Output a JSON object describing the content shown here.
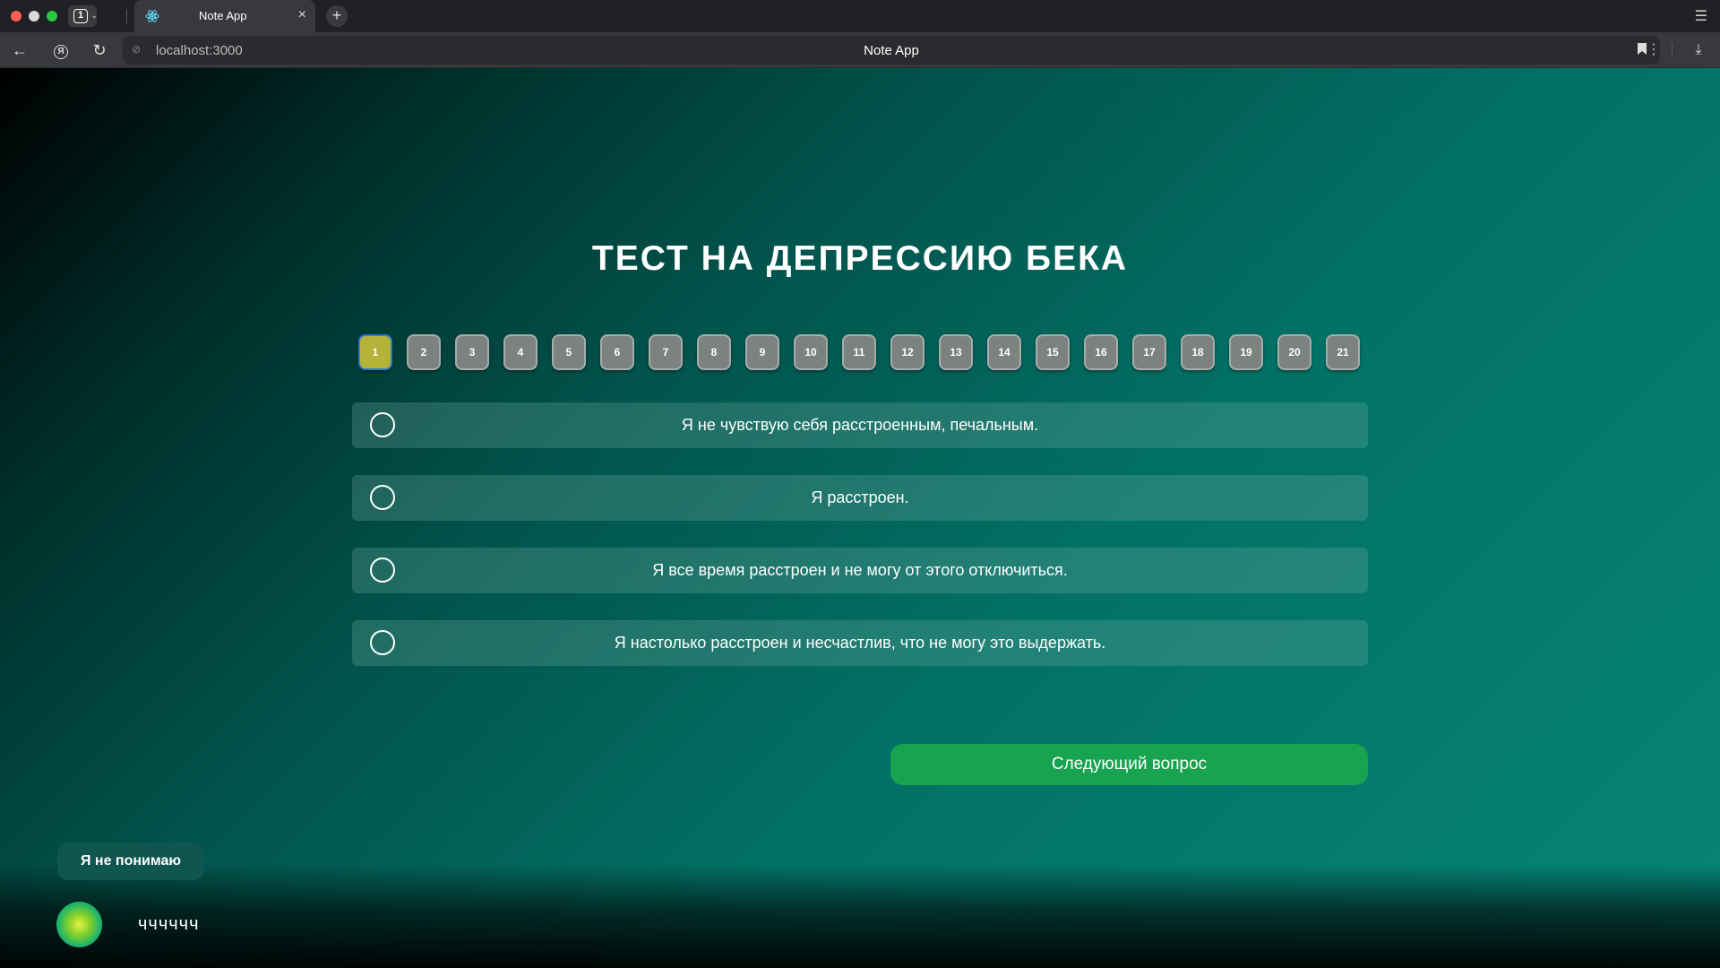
{
  "browser": {
    "tab_count": "1",
    "tab_title": "Note App",
    "url": "localhost:3000",
    "page_title": "Note App"
  },
  "quiz": {
    "title": "ТЕСТ НА ДЕПРЕССИЮ БЕКА",
    "question_numbers": [
      "1",
      "2",
      "3",
      "4",
      "5",
      "6",
      "7",
      "8",
      "9",
      "10",
      "11",
      "12",
      "13",
      "14",
      "15",
      "16",
      "17",
      "18",
      "19",
      "20",
      "21"
    ],
    "active_question": "1",
    "options": [
      "Я не чувствую себя расстроенным, печальным.",
      "Я расстроен.",
      "Я все время расстроен и не могу от этого отключиться.",
      "Я настолько расстроен и несчастлив, что не могу это выдержать."
    ],
    "next_button": "Следующий вопрос"
  },
  "footer": {
    "help_button": "Я не понимаю",
    "username": "чччччч"
  },
  "colors": {
    "active_question": "#b5b238",
    "active_border": "#2f7bd6",
    "next_button": "#17a34f"
  }
}
